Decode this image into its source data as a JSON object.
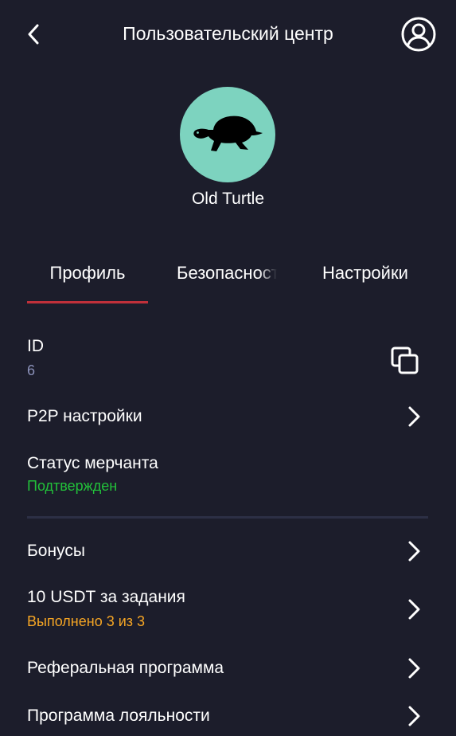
{
  "header": {
    "title": "Пользовательский центр",
    "back_icon": "chevron-left-icon",
    "user_icon": "user-circle-icon"
  },
  "profile": {
    "avatar_icon": "turtle-icon",
    "avatar_bg": "#7dd3bf",
    "username": "Old Turtle"
  },
  "tabs": [
    {
      "label": "Профиль",
      "active": true
    },
    {
      "label": "Безопасность",
      "active": false
    },
    {
      "label": "Настройки",
      "active": false
    }
  ],
  "rows": {
    "id": {
      "title": "ID",
      "value": "6",
      "icon": "copy-icon"
    },
    "p2p": {
      "title": "P2P настройки"
    },
    "merchant": {
      "title": "Статус мерчанта",
      "status": "Подтвержден"
    },
    "bonuses": {
      "title": "Бонусы"
    },
    "tasks": {
      "title": "10 USDT за задания",
      "progress": "Выполнено 3 из 3"
    },
    "referral": {
      "title": "Реферальная программа"
    },
    "loyalty": {
      "title": "Программа лояльности"
    }
  },
  "colors": {
    "background": "#1c1d2b",
    "accent_red": "#c0303a",
    "status_green": "#22c13a",
    "progress_orange": "#f5a524",
    "id_value": "#8a90b8"
  }
}
